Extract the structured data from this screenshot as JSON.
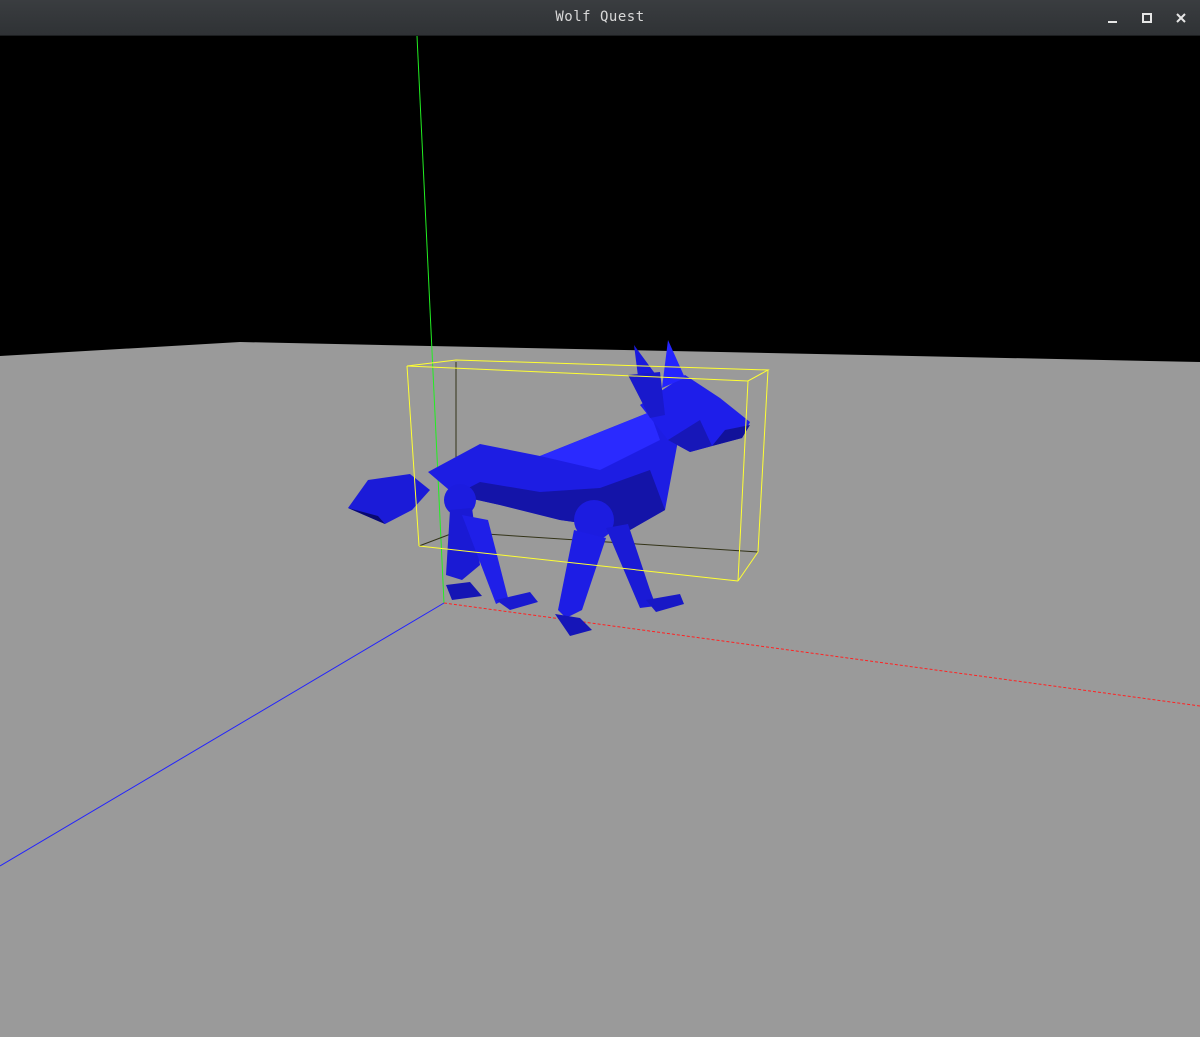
{
  "window": {
    "title": "Wolf Quest",
    "controls": [
      "minimize-icon",
      "maximize-icon",
      "close-icon"
    ]
  },
  "scene": {
    "sky_color": "#000000",
    "ground_color": "#9a9a9a",
    "model_color": "#1a1ae6",
    "bounding_box_color": "#ffff33",
    "axis_colors": {
      "x": "#ff2222",
      "y": "#22ee22",
      "z": "#2222ff"
    }
  }
}
